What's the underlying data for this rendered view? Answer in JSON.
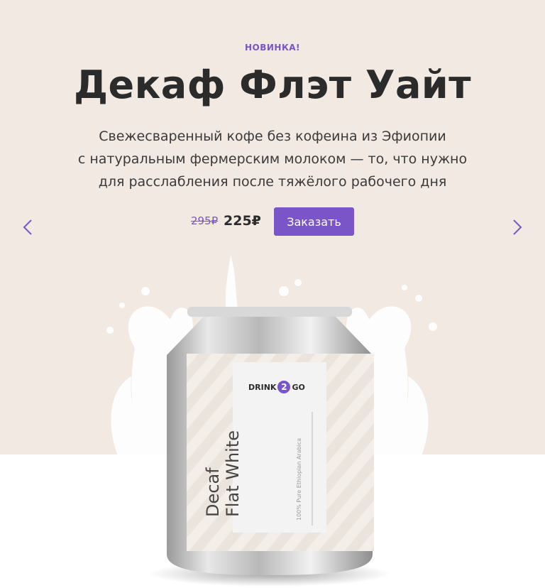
{
  "hero": {
    "badge": "НОВИНКА!",
    "title": "Декаф Флэт Уайт",
    "description_lines": [
      "Свежесваренный кофе без кофеина из Эфиопии",
      "с натуральным фермерским молоком — то, что нужно",
      "для расслабления после тяжёлого рабочего дня"
    ],
    "old_price": "295₽",
    "new_price": "225₽",
    "order_label": "Заказать"
  },
  "carousel": {
    "prev_icon": "chevron-left-icon",
    "next_icon": "chevron-right-icon"
  },
  "product": {
    "brand_left": "DRINK",
    "brand_logo": "2",
    "brand_right": "GO",
    "name_line1": "Decaf",
    "name_line2": "Flat White",
    "subtitle": "100% Pure Ethiopian Arabica"
  },
  "colors": {
    "accent": "#7a55c8",
    "hero_bg": "#f2e9e2",
    "text": "#2b2b2b"
  }
}
